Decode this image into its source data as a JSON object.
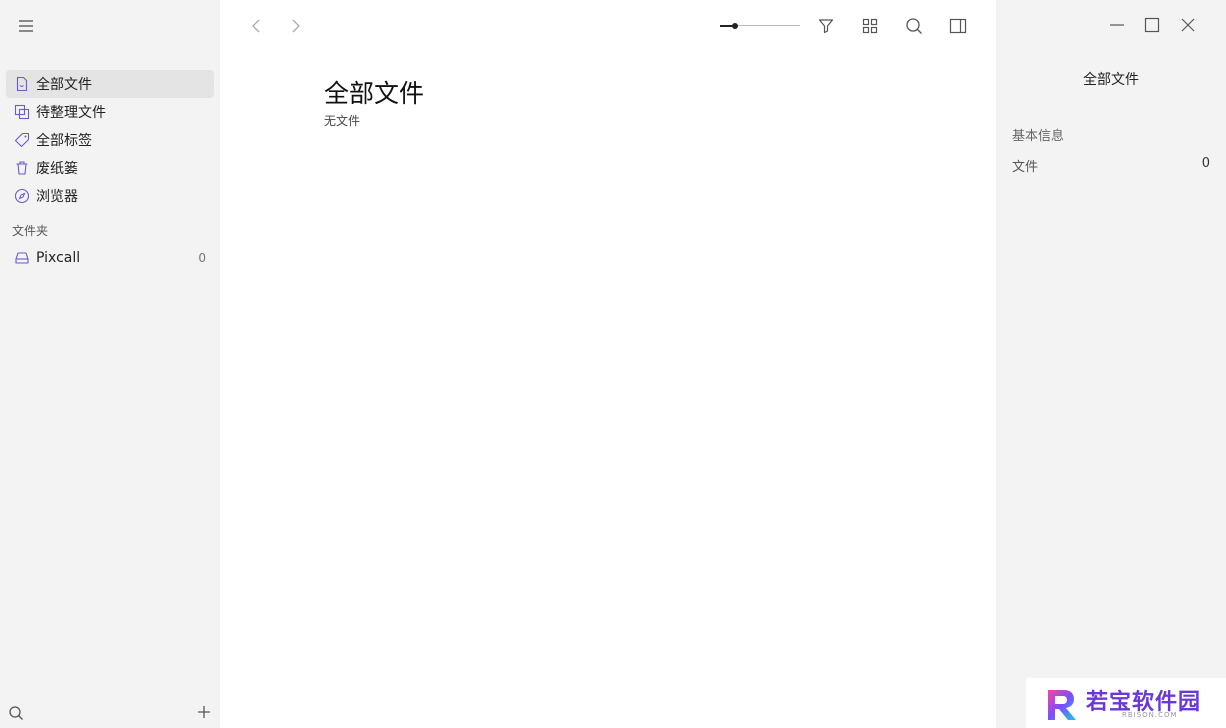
{
  "sidebar": {
    "nav_items": [
      {
        "label": "全部文件",
        "icon": "file-icon",
        "active": true
      },
      {
        "label": "待整理文件",
        "icon": "copy-icon",
        "active": false
      },
      {
        "label": "全部标签",
        "icon": "tag-icon",
        "active": false
      },
      {
        "label": "废纸篓",
        "icon": "trash-icon",
        "active": false
      },
      {
        "label": "浏览器",
        "icon": "compass-icon",
        "active": false
      }
    ],
    "folders_label": "文件夹",
    "folders": [
      {
        "label": "Pixcall",
        "count": "0",
        "icon": "drive-icon"
      }
    ]
  },
  "toolbar": {
    "zoom_level": 0.19
  },
  "main": {
    "title": "全部文件",
    "subtitle": "无文件"
  },
  "info_panel": {
    "title": "全部文件",
    "section": "基本信息",
    "rows": [
      {
        "label": "文件",
        "value": "0"
      }
    ]
  },
  "watermark": {
    "text": "若宝软件园",
    "small": "RBISON.COM"
  },
  "colors": {
    "accent": "#6a5acd",
    "sidebar_bg": "#f3f3f3",
    "active_bg": "#e4e4e4"
  }
}
